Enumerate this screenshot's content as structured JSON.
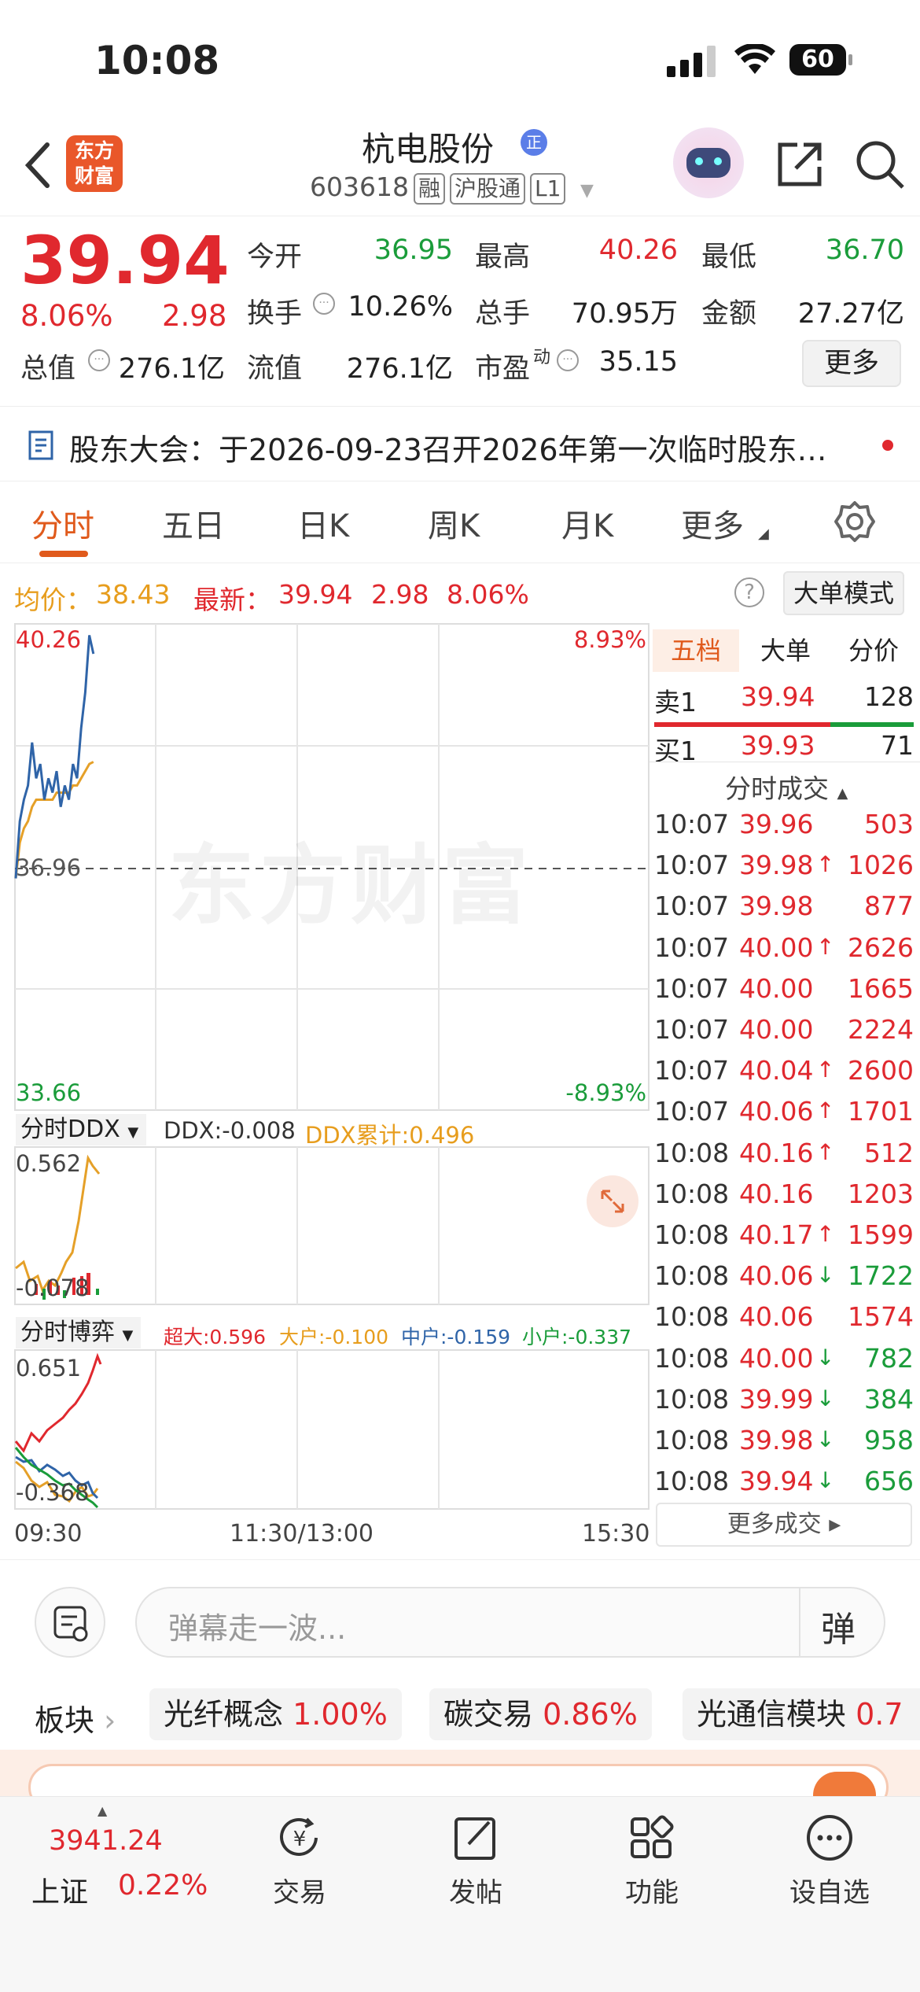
{
  "status": {
    "time": "10:08",
    "battery": "60"
  },
  "header": {
    "logo_line1": "东方",
    "logo_line2": "财富",
    "name": "杭电股份",
    "code": "603618",
    "tags": [
      "融",
      "沪股通",
      "L1"
    ]
  },
  "quote": {
    "price": "39.94",
    "pct": "8.06%",
    "chg": "2.98",
    "open_label": "今开",
    "open": "36.95",
    "high_label": "最高",
    "high": "40.26",
    "low_label": "最低",
    "low": "36.70",
    "turnover_label": "换手",
    "turnover": "10.26%",
    "volume_label": "总手",
    "volume": "70.95万",
    "amount_label": "金额",
    "amount": "27.27亿",
    "mcap_label": "总值",
    "mcap": "276.1亿",
    "float_label": "流值",
    "float": "276.1亿",
    "pe_label": "市盈",
    "pe_sup": "动",
    "pe": "35.15",
    "more": "更多"
  },
  "notice": {
    "text": "股东大会：于2026-09-23召开2026年第一次临时股东…"
  },
  "tabs": [
    "分时",
    "五日",
    "日K",
    "周K",
    "月K",
    "更多"
  ],
  "info": {
    "avg_label": "均价：",
    "avg": "38.43",
    "last_label": "最新：",
    "last": "39.94",
    "chg": "2.98",
    "pct": "8.06%",
    "mode": "大单模式"
  },
  "chart": {
    "y_top": "40.26",
    "y_mid": "36.96",
    "y_bot": "33.66",
    "pct_top": "8.93%",
    "pct_bot": "-8.93%",
    "watermark": "东方财富",
    "ddx_title": "分时DDX",
    "ddx_val": "DDX:-0.008",
    "ddx_cum": "DDX累计:0.496",
    "ddx_top": "0.562",
    "ddx_bot": "-0.078",
    "game_title": "分时博弈",
    "super": "超大:0.596",
    "big": "大户:-0.100",
    "mid": "中户:-0.159",
    "small": "小户:-0.337",
    "game_top": "0.651",
    "game_bot": "-0.368",
    "times": [
      "09:30",
      "11:30/13:00",
      "15:30"
    ]
  },
  "chart_data": {
    "type": "line",
    "title": "",
    "xlabel": "",
    "ylabel": "",
    "ylim": [
      33.66,
      40.26
    ],
    "prev_close": 36.96,
    "x": [
      "09:30",
      "09:32",
      "09:34",
      "09:36",
      "09:38",
      "09:40",
      "09:42",
      "09:44",
      "09:46",
      "09:48",
      "09:50",
      "09:52",
      "09:54",
      "09:56",
      "09:58",
      "10:00",
      "10:02",
      "10:04",
      "10:06",
      "10:08"
    ],
    "series": [
      {
        "values": [
          36.8,
          37.6,
          37.9,
          38.1,
          38.7,
          38.2,
          38.4,
          37.9,
          38.2,
          38.0,
          38.3,
          37.8,
          38.1,
          37.9,
          38.4,
          38.2,
          38.9,
          39.4,
          40.2,
          39.94
        ]
      },
      {
        "values": [
          36.8,
          37.3,
          37.5,
          37.6,
          37.8,
          37.9,
          37.9,
          37.9,
          37.9,
          37.9,
          38.0,
          38.0,
          38.0,
          38.0,
          38.1,
          38.1,
          38.2,
          38.3,
          38.4,
          38.43
        ]
      }
    ]
  },
  "book": {
    "tabs": [
      "五档",
      "大单",
      "分价"
    ],
    "ask_label": "卖1",
    "ask_price": "39.94",
    "ask_vol": "128",
    "bid_label": "买1",
    "bid_price": "39.93",
    "bid_vol": "71",
    "trades_title": "分时成交",
    "trades": [
      {
        "t": "10:07",
        "p": "39.96",
        "a": "",
        "v": "503"
      },
      {
        "t": "10:07",
        "p": "39.98",
        "a": "↑",
        "v": "1026"
      },
      {
        "t": "10:07",
        "p": "39.98",
        "a": "",
        "v": "877"
      },
      {
        "t": "10:07",
        "p": "40.00",
        "a": "↑",
        "v": "2626"
      },
      {
        "t": "10:07",
        "p": "40.00",
        "a": "",
        "v": "1665"
      },
      {
        "t": "10:07",
        "p": "40.00",
        "a": "",
        "v": "2224"
      },
      {
        "t": "10:07",
        "p": "40.04",
        "a": "↑",
        "v": "2600"
      },
      {
        "t": "10:07",
        "p": "40.06",
        "a": "↑",
        "v": "1701"
      },
      {
        "t": "10:08",
        "p": "40.16",
        "a": "↑",
        "v": "512"
      },
      {
        "t": "10:08",
        "p": "40.16",
        "a": "",
        "v": "1203"
      },
      {
        "t": "10:08",
        "p": "40.17",
        "a": "↑",
        "v": "1599"
      },
      {
        "t": "10:08",
        "p": "40.06",
        "a": "↓",
        "v": "1722"
      },
      {
        "t": "10:08",
        "p": "40.06",
        "a": "",
        "v": "1574"
      },
      {
        "t": "10:08",
        "p": "40.00",
        "a": "↓",
        "v": "782"
      },
      {
        "t": "10:08",
        "p": "39.99",
        "a": "↓",
        "v": "384"
      },
      {
        "t": "10:08",
        "p": "39.98",
        "a": "↓",
        "v": "958"
      },
      {
        "t": "10:08",
        "p": "39.94",
        "a": "↓",
        "v": "656"
      }
    ],
    "more_trades": "更多成交"
  },
  "comment": {
    "placeholder": "弹幕走一波...",
    "danmu": "弹"
  },
  "sectors": {
    "label": "板块",
    "items": [
      {
        "name": "光纤概念",
        "pct": "1.00%"
      },
      {
        "name": "碳交易",
        "pct": "0.86%"
      },
      {
        "name": "光通信模块",
        "pct": "0.7"
      }
    ]
  },
  "tabbar": {
    "index_val": "3941.24",
    "index_name": "上证",
    "index_pct": "0.22%",
    "items": [
      "交易",
      "发帖",
      "功能",
      "设自选"
    ]
  }
}
